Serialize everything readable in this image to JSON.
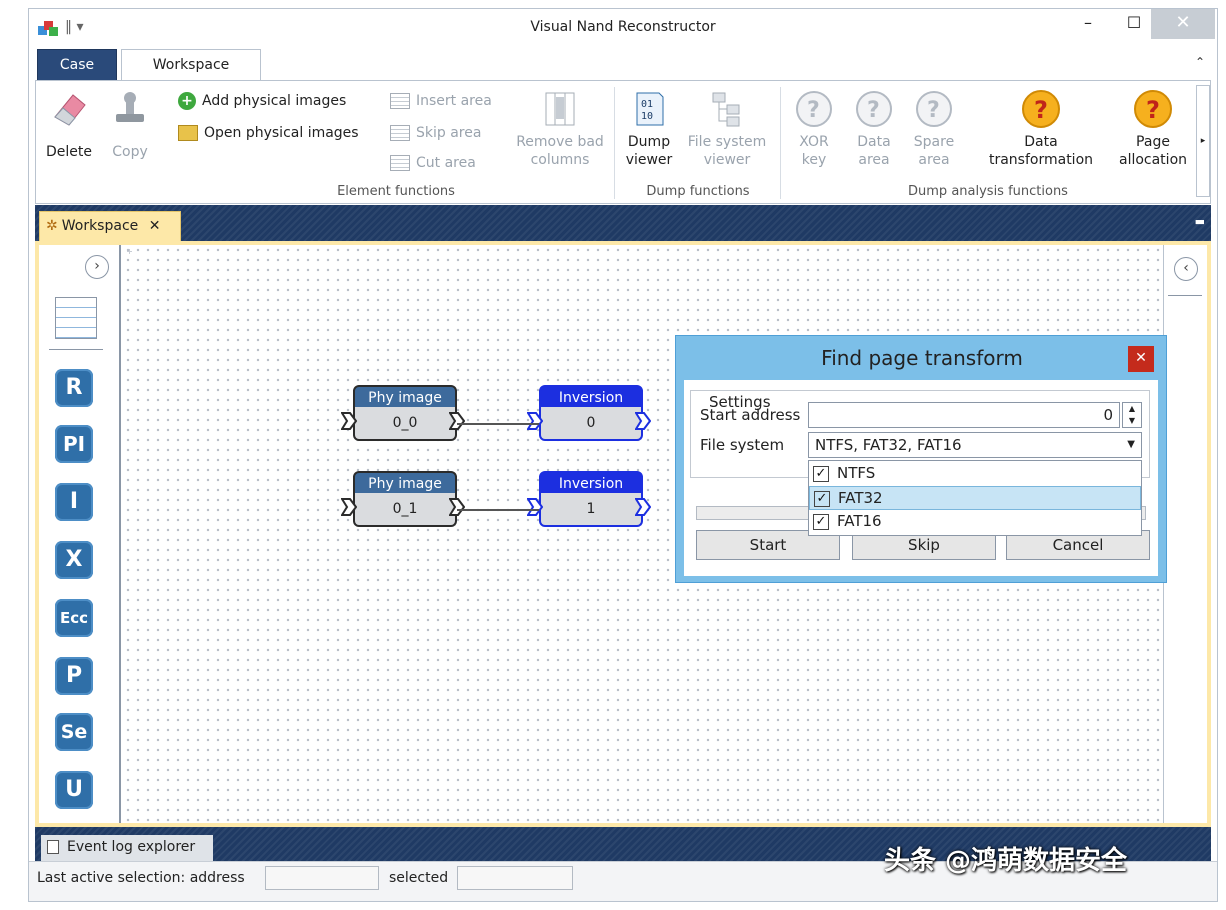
{
  "window": {
    "title": "Visual Nand Reconstructor",
    "close_symbol": "✕",
    "max_symbol": "☐",
    "min_symbol": "–"
  },
  "tabs": {
    "case": "Case",
    "workspace": "Workspace"
  },
  "ribbon": {
    "element_functions": {
      "label": "Element functions",
      "delete": "Delete",
      "copy": "Copy",
      "add_images": "Add physical images",
      "open_images": "Open physical images",
      "insert_area": "Insert area",
      "skip_area": "Skip area",
      "cut_area": "Cut area",
      "remove_bad_1": "Remove bad",
      "remove_bad_2": "columns"
    },
    "dump_functions": {
      "label": "Dump functions",
      "dump_viewer_1": "Dump",
      "dump_viewer_2": "viewer",
      "fs_viewer_1": "File system",
      "fs_viewer_2": "viewer"
    },
    "dump_analysis": {
      "label": "Dump analysis functions",
      "xor_1": "XOR",
      "xor_2": "key",
      "data_area_1": "Data",
      "data_area_2": "area",
      "spare_area_1": "Spare",
      "spare_area_2": "area",
      "data_trans_1": "Data",
      "data_trans_2": "transformation",
      "page_alloc_1": "Page",
      "page_alloc_2": "allocation"
    }
  },
  "workspace_tab": "Workspace",
  "tools": [
    "R",
    "PI",
    "I",
    "X",
    "Ecc",
    "P",
    "Se",
    "U"
  ],
  "nodes": [
    {
      "title": "Phy image",
      "value": "0_0"
    },
    {
      "title": "Inversion",
      "value": "0"
    },
    {
      "title": "Phy image",
      "value": "0_1"
    },
    {
      "title": "Inversion",
      "value": "1"
    }
  ],
  "dialog": {
    "title": "Find page transform",
    "settings": "Settings",
    "start_address_label": "Start address",
    "start_address_value": "0",
    "file_system_label": "File system",
    "file_system_value": "NTFS, FAT32, FAT16",
    "options": [
      {
        "label": "NTFS",
        "checked": true
      },
      {
        "label": "FAT32",
        "checked": true,
        "highlighted": true
      },
      {
        "label": "FAT16",
        "checked": true
      }
    ],
    "start": "Start",
    "skip": "Skip",
    "cancel": "Cancel"
  },
  "event_log": "Event log explorer",
  "status": {
    "last_active": "Last active selection:  address",
    "selected": "selected"
  },
  "watermark": "头条 @鸿萌数据安全",
  "colors": {
    "tool_blue": "#2f6fa8",
    "inversion_blue": "#1c2fe0",
    "phy_header": "#3d6a9c",
    "dialog_frame": "#7cbfe8"
  }
}
